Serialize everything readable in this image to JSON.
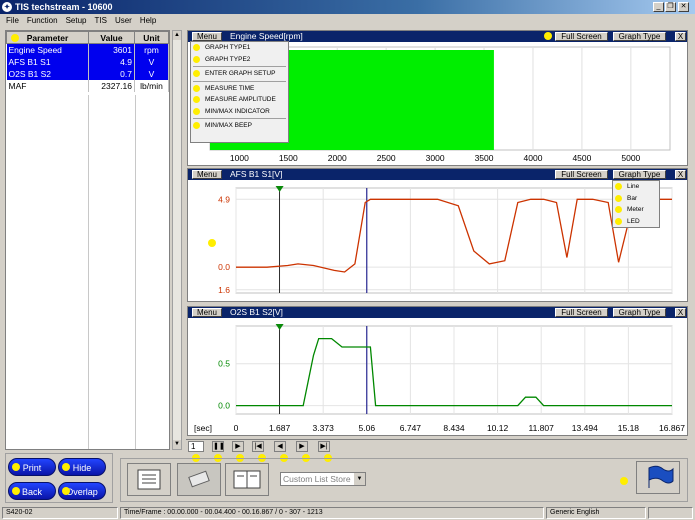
{
  "window": {
    "title": "TIS techstream - 10600"
  },
  "menubar": [
    "File",
    "Function",
    "Setup",
    "TIS",
    "User",
    "Help"
  ],
  "grid": {
    "headers": [
      "Parameter",
      "Value",
      "Unit"
    ],
    "rows": [
      {
        "param": "Engine Speed",
        "value": "3601",
        "unit": "rpm",
        "selected": true
      },
      {
        "param": "AFS B1 S1",
        "value": "4.9",
        "unit": "V",
        "selected": true
      },
      {
        "param": "O2S B1 S2",
        "value": "0.7",
        "unit": "V",
        "selected": true
      },
      {
        "param": "MAF",
        "value": "2327.16",
        "unit": "lb/min",
        "selected": false
      }
    ]
  },
  "panels": {
    "p1": {
      "menu": "Menu",
      "title": "Engine Speed[rpm]",
      "full": "Full Screen",
      "gtype": "Graph Type",
      "close": "X",
      "menu_items": [
        "GRAPH TYPE1",
        "GRAPH TYPE2",
        "ENTER GRAPH SETUP",
        "MEASURE TIME",
        "MEASURE AMPLITUDE",
        "MIN/MAX INDICATOR",
        "MIN/MAX BEEP"
      ],
      "ticks": [
        "1000",
        "1500",
        "2000",
        "2500",
        "3000",
        "3500",
        "4000",
        "4500",
        "5000"
      ]
    },
    "p2": {
      "menu": "Menu",
      "title": "AFS B1 S1[V]",
      "full": "Full Screen",
      "gtype": "Graph Type",
      "close": "X",
      "ytop": "4.9",
      "ymid": "0.0",
      "ybot": "1.6",
      "gtype_items": [
        "Line",
        "Bar",
        "Meter",
        "LED"
      ]
    },
    "p3": {
      "menu": "Menu",
      "title": "O2S B1 S2[V]",
      "full": "Full Screen",
      "gtype": "Graph Type",
      "close": "X",
      "y1": "0.5",
      "y0": "0.0"
    }
  },
  "xaxis": {
    "unit": "[sec]",
    "ticks": [
      "0",
      "1.687",
      "3.373",
      "5.06",
      "6.747",
      "8.434",
      "10.12",
      "11.807",
      "13.494",
      "15.18",
      "16.867"
    ]
  },
  "playback": {
    "frame": "1"
  },
  "buttons": {
    "print": "Print",
    "hide": "Hide",
    "back": "Back",
    "overlap": "Overlap",
    "list_store": "Custom List Store"
  },
  "status": {
    "left": "S420-02",
    "time": "Time/Frame : 00.00.000 - 00.04.400 - 00.16.867 / 0 - 307 - 1213",
    "lang": "Generic English"
  },
  "colors": {
    "engine_bar": "#00ee00",
    "afs_line": "#cc3300",
    "o2s_line": "#008800",
    "header": "#0a246a",
    "cursor": "#000080"
  },
  "chart_data": [
    {
      "type": "bar",
      "title": "Engine Speed[rpm]",
      "categories": [
        "Engine Speed"
      ],
      "values": [
        3601
      ],
      "xlim": [
        700,
        5400
      ]
    },
    {
      "type": "line",
      "title": "AFS B1 S1[V]",
      "x": [
        0,
        1.2,
        2.0,
        2.4,
        3.0,
        3.8,
        4.2,
        4.6,
        5.0,
        5.2,
        5.8,
        6.4,
        7.0,
        7.8,
        8.6,
        9.2,
        9.8,
        10.4,
        10.9,
        11.4,
        11.9,
        12.4,
        12.8,
        13.2,
        13.8,
        14.4,
        14.8,
        15.4,
        16.0,
        16.867
      ],
      "series": [
        {
          "values": [
            0.0,
            0.0,
            0.1,
            0.2,
            0.1,
            -0.2,
            -0.3,
            0.2,
            4.0,
            4.2,
            4.2,
            4.2,
            4.2,
            4.2,
            3.8,
            1.0,
            0.2,
            0.4,
            4.0,
            4.2,
            4.2,
            4.0,
            0.6,
            4.2,
            4.2,
            4.0,
            0.3,
            4.2,
            4.2,
            4.2
          ]
        }
      ],
      "ylabels": [
        "4.9",
        "0.0",
        "1.6"
      ]
    },
    {
      "type": "line",
      "title": "O2S B1 S2[V]",
      "x": [
        0,
        2.6,
        3.0,
        3.2,
        3.7,
        4.1,
        4.6,
        5.2,
        5.4,
        10.9,
        11.2,
        11.6,
        11.9,
        16.867
      ],
      "series": [
        {
          "values": [
            0.0,
            0.0,
            0.6,
            0.8,
            0.8,
            0.7,
            0.7,
            0.7,
            0.0,
            0.0,
            0.1,
            0.1,
            0.0,
            0.0
          ]
        }
      ],
      "ylabels": [
        "0.5",
        "0.0"
      ]
    }
  ]
}
